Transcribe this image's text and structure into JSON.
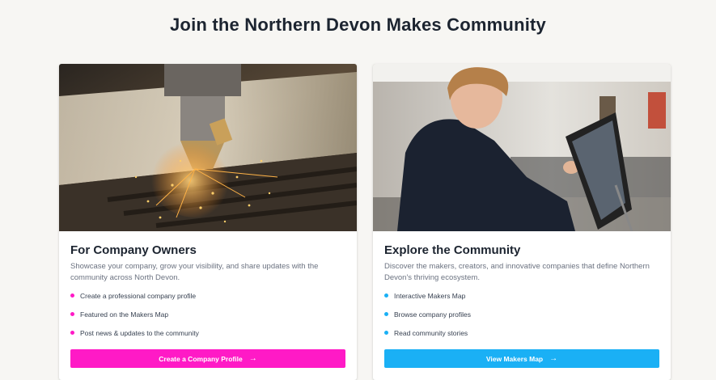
{
  "page": {
    "title": "Join the Northern Devon Makes Community"
  },
  "colors": {
    "owners_accent": "#ff1ac6",
    "explore_accent": "#1ab0f5"
  },
  "cards": [
    {
      "title": "For Company Owners",
      "description": "Showcase your company, grow your visibility, and share updates with the community across North Devon.",
      "features": [
        "Create a professional company profile",
        "Featured on the Makers Map",
        "Post news & updates to the community"
      ],
      "cta_label": "Create a Company Profile",
      "cta_icon": "arrow-right-icon"
    },
    {
      "title": "Explore the Community",
      "description": "Discover the makers, creators, and innovative companies that define Northern Devon's thriving ecosystem.",
      "features": [
        "Interactive Makers Map",
        "Browse company profiles",
        "Read community stories"
      ],
      "cta_label": "View Makers Map",
      "cta_icon": "arrow-right-icon"
    }
  ]
}
